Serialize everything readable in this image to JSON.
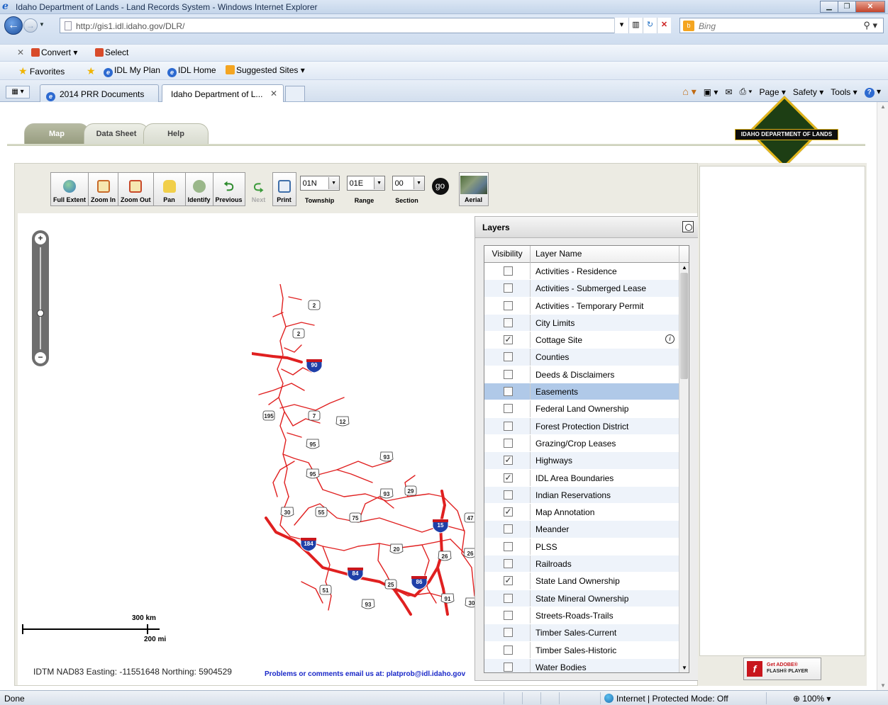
{
  "browser": {
    "window_title": "Idaho Department of Lands - Land Records System - Windows Internet Explorer",
    "url": "http://gis1.idl.idaho.gov/DLR/",
    "search_placeholder": "Bing",
    "toolbar": {
      "convert": "Convert",
      "select": "Select"
    },
    "favorites": {
      "label": "Favorites",
      "items": [
        "IDL My Plan",
        "IDL Home",
        "Suggested Sites"
      ]
    },
    "tabs": [
      {
        "label": "2014 PRR Documents",
        "active": false
      },
      {
        "label": "Idaho Department of L...",
        "active": true
      }
    ],
    "commands": [
      "Page",
      "Safety",
      "Tools"
    ],
    "status": {
      "left": "Done",
      "zone": "Internet | Protected Mode: Off",
      "zoom": "100%"
    }
  },
  "app": {
    "tabs": [
      "Map",
      "Data Sheet",
      "Help"
    ],
    "active_tab": "Map",
    "logo_text": "IDAHO DEPARTMENT OF LANDS",
    "tools": [
      {
        "label": "Full Extent",
        "icon": "globe-icon",
        "enabled": true
      },
      {
        "label": "Zoom In",
        "icon": "zoom-in-icon",
        "enabled": true
      },
      {
        "label": "Zoom Out",
        "icon": "zoom-out-icon",
        "enabled": true
      },
      {
        "label": "Pan",
        "icon": "hand-icon",
        "enabled": true
      },
      {
        "label": "Identify",
        "icon": "identify-icon",
        "enabled": true
      },
      {
        "label": "Previous",
        "icon": "back-arrow-icon",
        "enabled": true
      },
      {
        "label": "Next",
        "icon": "forward-arrow-icon",
        "enabled": false
      },
      {
        "label": "Print",
        "icon": "printer-icon",
        "enabled": true
      }
    ],
    "township": {
      "value": "01N",
      "caption": "Township"
    },
    "range": {
      "value": "01E",
      "caption": "Range"
    },
    "section": {
      "value": "00",
      "caption": "Section"
    },
    "go_label": "go",
    "aerial_label": "Aerial",
    "scale": {
      "km": "300 km",
      "mi": "200 mi"
    },
    "coords": "IDTM NAD83  Easting: -11551648   Northing: 5904529",
    "problems": "Problems or comments email us at: platprob@idl.idaho.gov",
    "flash": {
      "get": "Get",
      "adobe": "ADOBE®",
      "player": "FLASH® PLAYER"
    }
  },
  "layers": {
    "title": "Layers",
    "col_visibility": "Visibility",
    "col_name": "Layer Name",
    "selected": "Easements",
    "items": [
      {
        "name": "Activities - Residence",
        "checked": false
      },
      {
        "name": "Activities - Submerged Lease",
        "checked": false
      },
      {
        "name": "Activities - Temporary Permit",
        "checked": false
      },
      {
        "name": "City Limits",
        "checked": false
      },
      {
        "name": "Cottage Site",
        "checked": true,
        "info": true
      },
      {
        "name": "Counties",
        "checked": false
      },
      {
        "name": "Deeds & Disclaimers",
        "checked": false
      },
      {
        "name": "Easements",
        "checked": false
      },
      {
        "name": "Federal Land Ownership",
        "checked": false
      },
      {
        "name": "Forest Protection District",
        "checked": false
      },
      {
        "name": "Grazing/Crop Leases",
        "checked": false
      },
      {
        "name": "Highways",
        "checked": true
      },
      {
        "name": "IDL Area Boundaries",
        "checked": true
      },
      {
        "name": "Indian Reservations",
        "checked": false
      },
      {
        "name": "Map Annotation",
        "checked": true
      },
      {
        "name": "Meander",
        "checked": false
      },
      {
        "name": "PLSS",
        "checked": false
      },
      {
        "name": "Railroads",
        "checked": false
      },
      {
        "name": "State Land Ownership",
        "checked": true
      },
      {
        "name": "State Mineral Ownership",
        "checked": false
      },
      {
        "name": "Streets-Roads-Trails",
        "checked": false
      },
      {
        "name": "Timber Sales-Current",
        "checked": false
      },
      {
        "name": "Timber Sales-Historic",
        "checked": false
      },
      {
        "name": "Water Bodies",
        "checked": false
      }
    ]
  },
  "map": {
    "road_color": "#e02020",
    "shields": [
      {
        "label": "2",
        "type": "state"
      },
      {
        "label": "2",
        "type": "state"
      },
      {
        "label": "90",
        "type": "interstate"
      },
      {
        "label": "195",
        "type": "state"
      },
      {
        "label": "7",
        "type": "state"
      },
      {
        "label": "12",
        "type": "us"
      },
      {
        "label": "95",
        "type": "us"
      },
      {
        "label": "93",
        "type": "us"
      },
      {
        "label": "95",
        "type": "us"
      },
      {
        "label": "93",
        "type": "us"
      },
      {
        "label": "29",
        "type": "state"
      },
      {
        "label": "30",
        "type": "us"
      },
      {
        "label": "55",
        "type": "state"
      },
      {
        "label": "75",
        "type": "state"
      },
      {
        "label": "47",
        "type": "state"
      },
      {
        "label": "15",
        "type": "interstate"
      },
      {
        "label": "184",
        "type": "interstate"
      },
      {
        "label": "20",
        "type": "us"
      },
      {
        "label": "26",
        "type": "us"
      },
      {
        "label": "26",
        "type": "us"
      },
      {
        "label": "84",
        "type": "interstate"
      },
      {
        "label": "86",
        "type": "interstate"
      },
      {
        "label": "25",
        "type": "state"
      },
      {
        "label": "51",
        "type": "state"
      },
      {
        "label": "91",
        "type": "us"
      },
      {
        "label": "30",
        "type": "us"
      },
      {
        "label": "93",
        "type": "us"
      }
    ]
  }
}
